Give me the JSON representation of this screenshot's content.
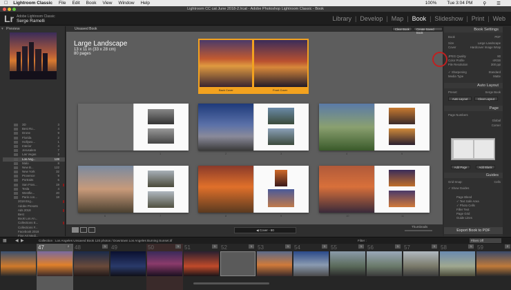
{
  "menubar": {
    "app": "Lightroom Classic",
    "items": [
      "File",
      "Edit",
      "Book",
      "View",
      "Window",
      "Help"
    ],
    "right": [
      "100%",
      "Tue 3:04 PM"
    ]
  },
  "window_title": "Lightroom CC cat June 2018-2.lrcat - Adobe Photoshop Lightroom Classic - Book",
  "identity": {
    "sub": "Adobe Lightroom Classic",
    "name": "Serge Ramelli"
  },
  "modules": [
    "Library",
    "Develop",
    "Map",
    "Book",
    "Slideshow",
    "Print",
    "Web"
  ],
  "active_module": "Book",
  "left_panel": {
    "title": "Preview",
    "collections": [
      {
        "label": "3D",
        "count": "3"
      },
      {
        "label": "Best Ro...",
        "count": "4"
      },
      {
        "label": "Drone",
        "count": "9"
      },
      {
        "label": "Florida",
        "count": "2"
      },
      {
        "label": "Hollywo...",
        "count": "1"
      },
      {
        "label": "Interior",
        "count": "4"
      },
      {
        "label": "Jerusalem",
        "count": "7"
      },
      {
        "label": "Las Vegas",
        "count": "3"
      },
      {
        "label": "Los Ang...",
        "count": "128"
      },
      {
        "label": "Malo",
        "count": "8"
      },
      {
        "label": "New B...",
        "count": "122"
      },
      {
        "label": "New York",
        "count": "32"
      },
      {
        "label": "Provence",
        "count": "9"
      },
      {
        "label": "Portraits",
        "count": "6"
      },
      {
        "label": "San Fran...",
        "count": "19"
      },
      {
        "label": "Tesla",
        "count": "4"
      },
      {
        "label": "Westfie...",
        "count": "20"
      },
      {
        "label": "Paris con...",
        "count": "18"
      },
      {
        "label": "2018 Eng...",
        "count": ""
      },
      {
        "label": "Adobe Presets",
        "count": ""
      },
      {
        "label": "Ads 2018",
        "count": ""
      },
      {
        "label": "Best",
        "count": ""
      },
      {
        "label": "Book Los An...",
        "count": ""
      },
      {
        "label": "Collections E...",
        "count": ""
      },
      {
        "label": "Collections F...",
        "count": ""
      },
      {
        "label": "Facebook 2018",
        "count": ""
      },
      {
        "label": "Fine Art Medi...",
        "count": ""
      }
    ]
  },
  "center": {
    "book_name": "Unsaved Book",
    "clear_button": "Clear Book",
    "create_button": "Create Saved Book",
    "book_title": "Large Landscape",
    "size": "13 x 11 in (33 x 28 cm)",
    "pages": "80 pages",
    "back_cover": "Back Cover",
    "front_cover": "Front Cover",
    "page_numbers": [
      "1",
      "2",
      "3",
      "4",
      "5",
      "6",
      "7",
      "8",
      "9",
      "10",
      "11"
    ],
    "footer_label": "Cover - 80",
    "thumbnails_label": "Thumbnails"
  },
  "right_panel": {
    "book_settings": "Book Settings",
    "book_label": "Book",
    "book_value": "PDF",
    "size_label": "Size",
    "size_value": "Large Landscape",
    "cover_label": "Cover",
    "cover_value": "Hardcover Image Wrap",
    "jpeg_label": "JPEG Quality",
    "jpeg_value": "80",
    "profile_label": "Color Profile",
    "profile_value": "sRGB",
    "res_label": "File Resolution",
    "res_value": "300 ppi",
    "sharp_label": "Sharpening",
    "sharp_value": "Standard",
    "media_label": "Media Type",
    "media_value": "Matte",
    "auto_layout": "Auto Layout",
    "preset_label": "Preset:",
    "preset_value": "Serge Book",
    "auto_btn": "Auto Layout",
    "clear_btn": "Clear Layout",
    "page": "Page",
    "page_numbers": "Page Numbers",
    "global_label": "Global",
    "corner_label": "Corner",
    "add_page": "Add Page",
    "add_blank": "Add Blank",
    "guides": "Guides",
    "grid_snap": "Grid Snap:",
    "grid_value": "Cells",
    "show_guides": "Show Guides",
    "guide_items": [
      "Page Bleed",
      "Text Safe Area",
      "Photo Cells",
      "Filler Text",
      "Page Grid",
      "Guide Lines"
    ],
    "export": "Export Book to PDF"
  },
  "filmstrip": {
    "source": "Collection : Los Angeles  Unsaved Book    120 photos / Downtown Los Angeles Burning Sunset.tif",
    "filter": "Filter :",
    "filter_value": "Filters Off",
    "numbers": [
      "",
      "47",
      "48",
      "49",
      "50",
      "51",
      "52",
      "53",
      "54",
      "55",
      "56",
      "57",
      "58",
      "59"
    ],
    "badges": [
      "",
      "2",
      "1",
      "",
      "1",
      "1",
      "1",
      "1",
      "1",
      "1",
      "1",
      "1",
      "1",
      "2"
    ]
  }
}
